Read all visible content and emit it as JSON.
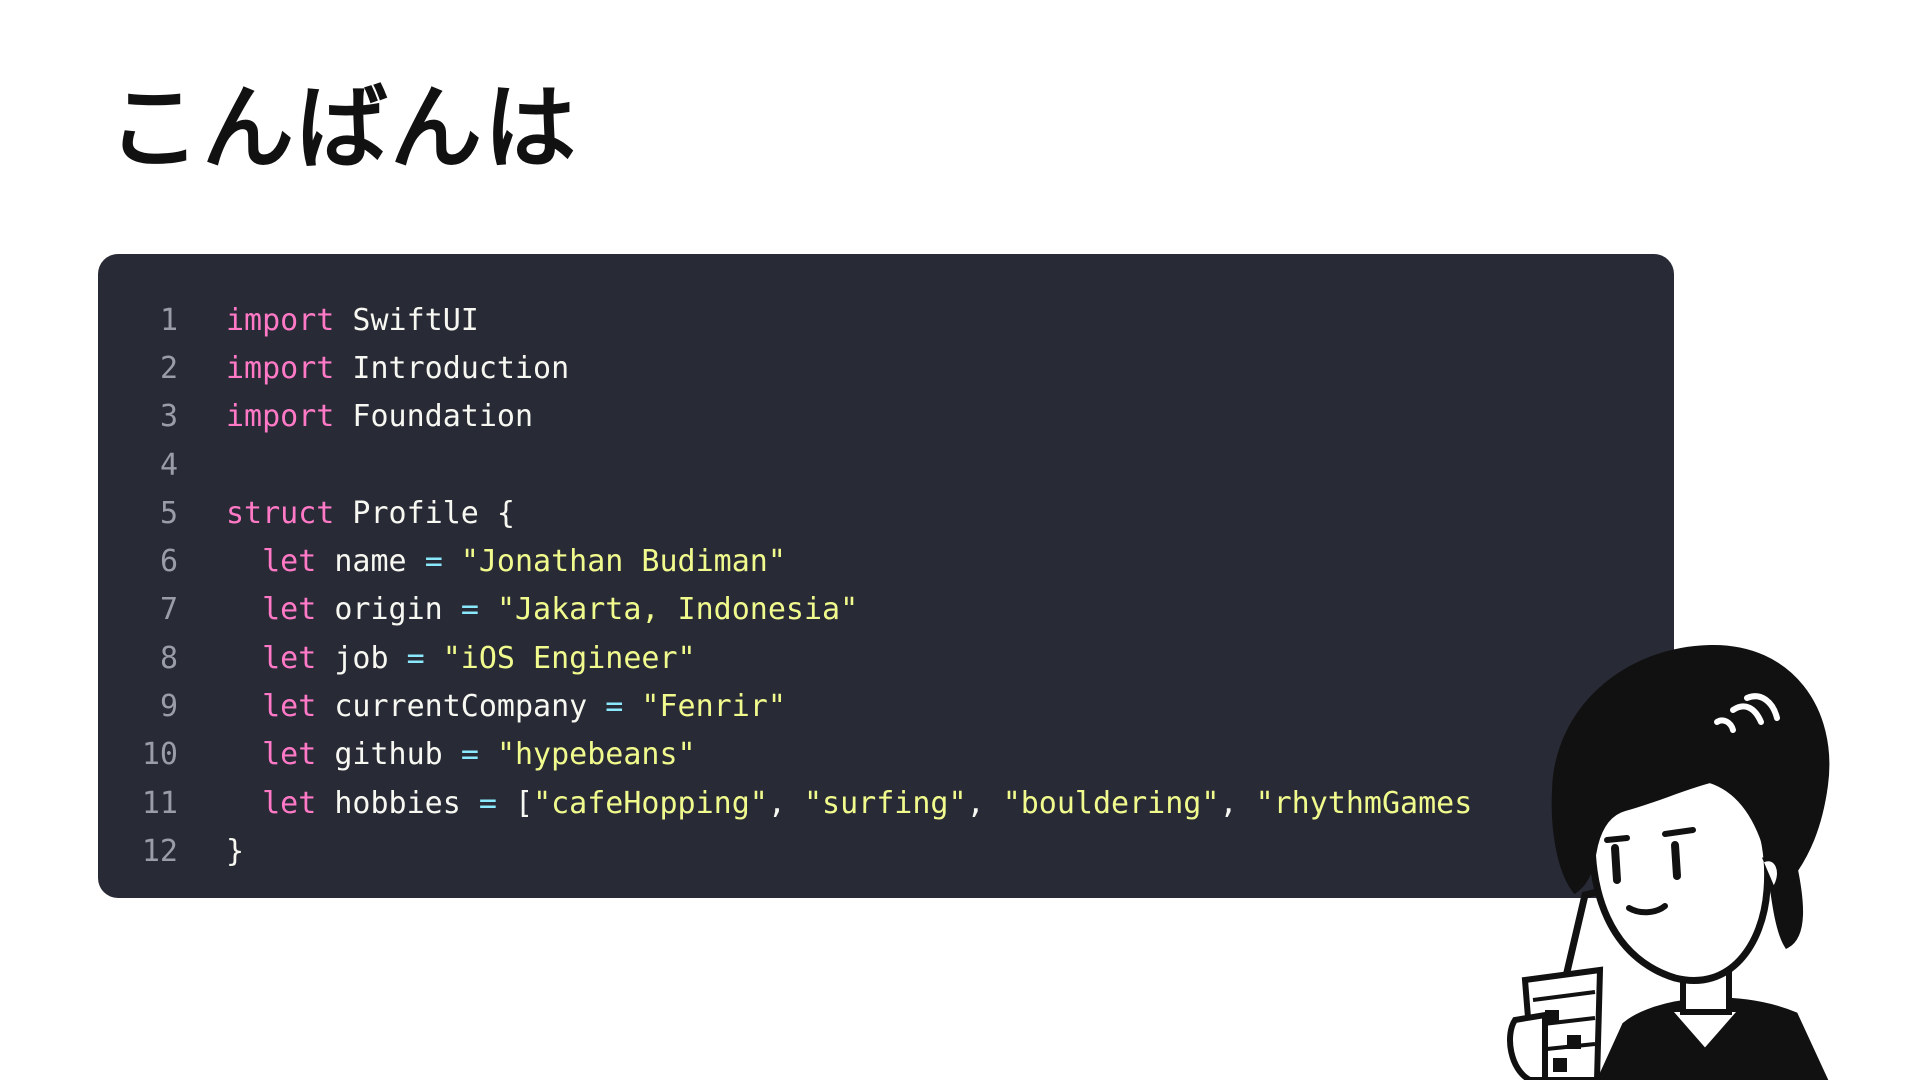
{
  "slide": {
    "title": "こんばんは"
  },
  "code": {
    "colors": {
      "background": "#282a36",
      "keyword": "#ff79c6",
      "identifier": "#f8f8f2",
      "operator": "#8be9fd",
      "string": "#f1fa8c",
      "line_number": "#9a9ca8"
    },
    "lines": [
      {
        "number": "1",
        "tokens": [
          {
            "type": "keyword",
            "text": "import"
          },
          {
            "type": "ident",
            "text": " SwiftUI"
          }
        ]
      },
      {
        "number": "2",
        "tokens": [
          {
            "type": "keyword",
            "text": "import"
          },
          {
            "type": "ident",
            "text": " Introduction"
          }
        ]
      },
      {
        "number": "3",
        "tokens": [
          {
            "type": "keyword",
            "text": "import"
          },
          {
            "type": "ident",
            "text": " Foundation"
          }
        ]
      },
      {
        "number": "4",
        "tokens": []
      },
      {
        "number": "5",
        "tokens": [
          {
            "type": "keyword",
            "text": "struct"
          },
          {
            "type": "ident",
            "text": " Profile {"
          }
        ]
      },
      {
        "number": "6",
        "tokens": [
          {
            "type": "ident",
            "text": "  "
          },
          {
            "type": "keyword",
            "text": "let"
          },
          {
            "type": "ident",
            "text": " name "
          },
          {
            "type": "operator",
            "text": "="
          },
          {
            "type": "ident",
            "text": " "
          },
          {
            "type": "string",
            "text": "\"Jonathan Budiman\""
          }
        ]
      },
      {
        "number": "7",
        "tokens": [
          {
            "type": "ident",
            "text": "  "
          },
          {
            "type": "keyword",
            "text": "let"
          },
          {
            "type": "ident",
            "text": " origin "
          },
          {
            "type": "operator",
            "text": "="
          },
          {
            "type": "ident",
            "text": " "
          },
          {
            "type": "string",
            "text": "\"Jakarta, Indonesia\""
          }
        ]
      },
      {
        "number": "8",
        "tokens": [
          {
            "type": "ident",
            "text": "  "
          },
          {
            "type": "keyword",
            "text": "let"
          },
          {
            "type": "ident",
            "text": " job "
          },
          {
            "type": "operator",
            "text": "="
          },
          {
            "type": "ident",
            "text": " "
          },
          {
            "type": "string",
            "text": "\"iOS Engineer\""
          }
        ]
      },
      {
        "number": "9",
        "tokens": [
          {
            "type": "ident",
            "text": "  "
          },
          {
            "type": "keyword",
            "text": "let"
          },
          {
            "type": "ident",
            "text": " currentCompany "
          },
          {
            "type": "operator",
            "text": "="
          },
          {
            "type": "ident",
            "text": " "
          },
          {
            "type": "string",
            "text": "\"Fenrir\""
          }
        ]
      },
      {
        "number": "10",
        "tokens": [
          {
            "type": "ident",
            "text": "  "
          },
          {
            "type": "keyword",
            "text": "let"
          },
          {
            "type": "ident",
            "text": " github "
          },
          {
            "type": "operator",
            "text": "="
          },
          {
            "type": "ident",
            "text": " "
          },
          {
            "type": "string",
            "text": "\"hypebeans\""
          }
        ]
      },
      {
        "number": "11",
        "tokens": [
          {
            "type": "ident",
            "text": "  "
          },
          {
            "type": "keyword",
            "text": "let"
          },
          {
            "type": "ident",
            "text": " hobbies "
          },
          {
            "type": "operator",
            "text": "="
          },
          {
            "type": "ident",
            "text": " ["
          },
          {
            "type": "string",
            "text": "\"cafeHopping\""
          },
          {
            "type": "punct",
            "text": ", "
          },
          {
            "type": "string",
            "text": "\"surfing\""
          },
          {
            "type": "punct",
            "text": ", "
          },
          {
            "type": "string",
            "text": "\"bouldering\""
          },
          {
            "type": "punct",
            "text": ", "
          },
          {
            "type": "string",
            "text": "\"rhythmGames"
          }
        ]
      },
      {
        "number": "12",
        "tokens": [
          {
            "type": "ident",
            "text": "}"
          }
        ]
      }
    ]
  },
  "illustration": {
    "icon": "avatar-illustration-icon"
  }
}
